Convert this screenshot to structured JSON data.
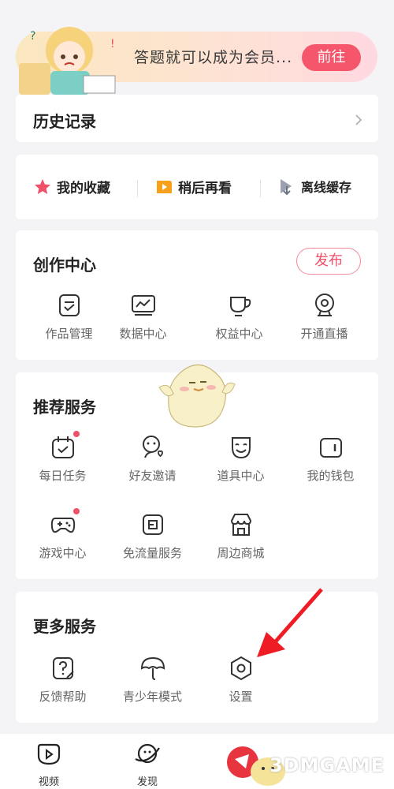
{
  "banner": {
    "text": "答题就可以成为会员...",
    "button": "前往"
  },
  "history": {
    "title": "历史记录"
  },
  "quick": [
    {
      "label": "我的收藏",
      "icon": "star-icon"
    },
    {
      "label": "稍后再看",
      "icon": "play-later-icon"
    },
    {
      "label": "离线缓存",
      "icon": "download-icon"
    }
  ],
  "creation": {
    "title": "创作中心",
    "publish": "发布",
    "items": [
      {
        "label": "作品管理",
        "icon": "works-icon"
      },
      {
        "label": "数据中心",
        "icon": "chart-icon"
      },
      {
        "label": "权益中心",
        "icon": "cup-icon"
      },
      {
        "label": "开通直播",
        "icon": "camera-icon"
      }
    ]
  },
  "recommended": {
    "title": "推荐服务",
    "items": [
      {
        "label": "每日任务",
        "icon": "calendar-icon",
        "dot": true
      },
      {
        "label": "好友邀请",
        "icon": "invite-icon",
        "dot": false
      },
      {
        "label": "道具中心",
        "icon": "mask-icon",
        "dot": false
      },
      {
        "label": "我的钱包",
        "icon": "wallet-icon",
        "dot": false
      },
      {
        "label": "游戏中心",
        "icon": "gamepad-icon",
        "dot": true
      },
      {
        "label": "免流量服务",
        "icon": "sim-icon",
        "dot": false
      },
      {
        "label": "周边商城",
        "icon": "store-icon",
        "dot": false
      }
    ]
  },
  "more": {
    "title": "更多服务",
    "items": [
      {
        "label": "反馈帮助",
        "icon": "help-icon"
      },
      {
        "label": "青少年模式",
        "icon": "umbrella-icon"
      },
      {
        "label": "设置",
        "icon": "settings-icon"
      }
    ]
  },
  "tabbar": [
    {
      "label": "视频",
      "icon": "video-tab-icon"
    },
    {
      "label": "发现",
      "icon": "planet-tab-icon"
    }
  ],
  "watermark": "3DMGAME",
  "colors": {
    "accent": "#f5566b",
    "star": "#f0506a",
    "later": "#f7a11a",
    "download": "#9aa0ad"
  }
}
